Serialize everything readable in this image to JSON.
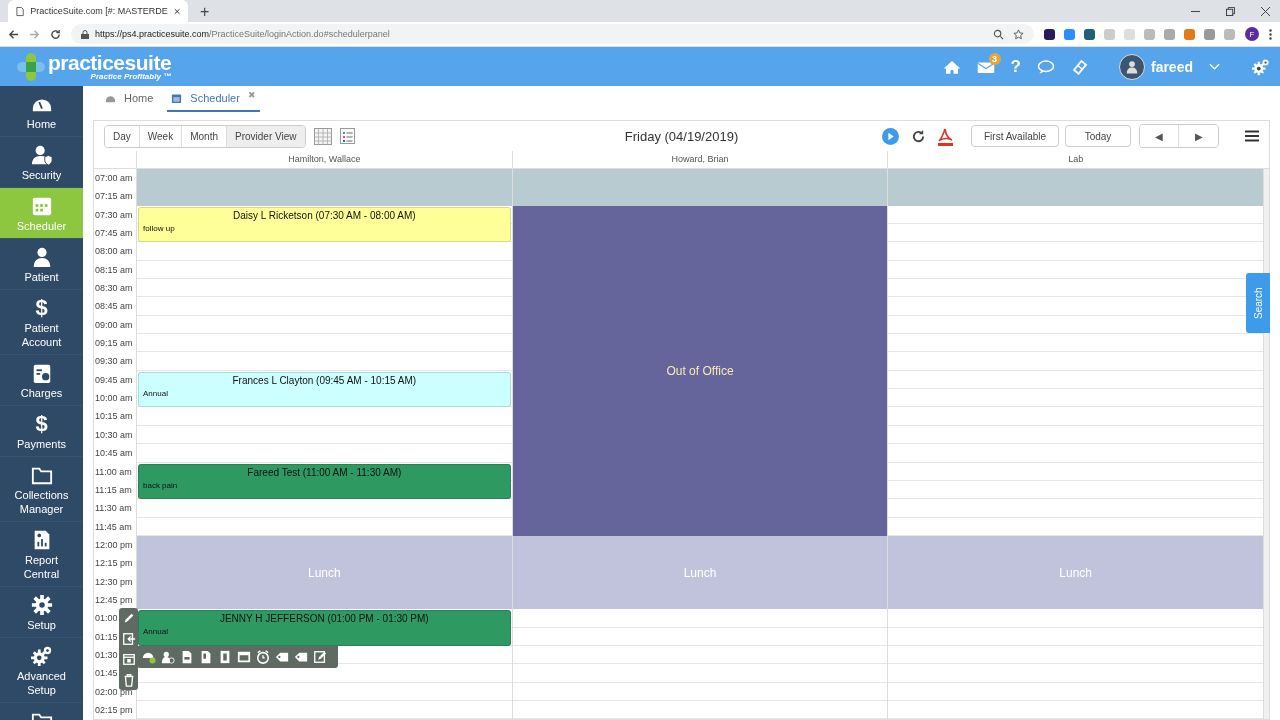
{
  "browser": {
    "tab_title": "PracticeSuite.com [#: MASTERDE",
    "new_tab": "+",
    "url_host": "https://ps4.practicesuite.com",
    "url_path": "/PracticeSuite/loginAction.do#schedulerpanel",
    "profile": "F"
  },
  "header": {
    "logo": "practicesuite",
    "tagline": "Practice Profitably ™",
    "mail_count": "3",
    "help": "?",
    "user": "fareed"
  },
  "sidebar": [
    {
      "label": "Home",
      "selected": false
    },
    {
      "label": "Security",
      "selected": false
    },
    {
      "label": "Scheduler",
      "selected": true
    },
    {
      "label": "Patient",
      "selected": false
    },
    {
      "label": "Patient Account",
      "glyph": "$",
      "selected": false
    },
    {
      "label": "Charges",
      "selected": false
    },
    {
      "label": "Payments",
      "glyph": "$",
      "selected": false
    },
    {
      "label": "Collections Manager",
      "selected": false
    },
    {
      "label": "Report Central",
      "selected": false
    },
    {
      "label": "Setup",
      "selected": false
    },
    {
      "label": "Advanced Setup",
      "selected": false
    }
  ],
  "tabs": [
    {
      "label": "Home",
      "selected": false
    },
    {
      "label": "Scheduler",
      "selected": true,
      "close": "✖"
    }
  ],
  "toolbar": {
    "views": [
      {
        "label": "Day",
        "selected": false
      },
      {
        "label": "Week",
        "selected": false
      },
      {
        "label": "Month",
        "selected": false
      },
      {
        "label": "Provider View",
        "selected": true
      }
    ],
    "date": "Friday (04/19/2019)",
    "first_available": "First Available",
    "today": "Today",
    "prev": "◀",
    "next": "▶"
  },
  "times": [
    "07:00 am",
    "07:15 am",
    "07:30 am",
    "07:45 am",
    "08:00 am",
    "08:15 am",
    "08:30 am",
    "08:45 am",
    "09:00 am",
    "09:15 am",
    "09:30 am",
    "09:45 am",
    "10:00 am",
    "10:15 am",
    "10:30 am",
    "10:45 am",
    "11:00 am",
    "11:15 am",
    "11:30 am",
    "11:45 am",
    "12:00 pm",
    "12:15 pm",
    "12:30 pm",
    "12:45 pm",
    "01:00",
    "01:15",
    "01:30",
    "01:45",
    "02:00 pm",
    "02:15 pm"
  ],
  "columns": [
    {
      "name": "Hamilton, Wallace",
      "slots": [
        {
          "kind": "blocked"
        },
        {
          "kind": "blocked"
        },
        {
          "kind": "appointment",
          "title": "Daisy L Ricketson (07:30 AM - 08:00 AM)",
          "note": "follow up",
          "color": "#ffff99"
        },
        {
          "kind": "continued"
        },
        {
          "kind": "open"
        },
        {
          "kind": "open"
        },
        {
          "kind": "open"
        },
        {
          "kind": "open"
        },
        {
          "kind": "open"
        },
        {
          "kind": "open"
        },
        {
          "kind": "open"
        },
        {
          "kind": "appointment",
          "title": "Frances L Clayton (09:45 AM - 10:15 AM)",
          "note": "Annual",
          "color": "#ccffff"
        },
        {
          "kind": "continued"
        },
        {
          "kind": "open"
        },
        {
          "kind": "open"
        },
        {
          "kind": "open"
        },
        {
          "kind": "appointment",
          "title": "Fareed Test (11:00 AM - 11:30 AM)",
          "note": "back pain",
          "color": "#2e9a62"
        },
        {
          "kind": "continued"
        },
        {
          "kind": "open"
        },
        {
          "kind": "open"
        },
        {
          "kind": "lunch",
          "label": "Lunch"
        },
        {
          "kind": "continued"
        },
        {
          "kind": "continued"
        },
        {
          "kind": "continued"
        },
        {
          "kind": "appointment",
          "title": "JENNY H JEFFERSON (01:00 PM - 01:30 PM)",
          "note": "Annual",
          "color": "#2e9a62"
        },
        {
          "kind": "continued"
        },
        {
          "kind": "open"
        },
        {
          "kind": "open"
        },
        {
          "kind": "open"
        },
        {
          "kind": "open"
        }
      ]
    },
    {
      "name": "Howard, Brian",
      "slots": [
        {
          "kind": "blocked"
        },
        {
          "kind": "blocked"
        },
        {
          "kind": "out",
          "label": "Out of Office"
        },
        {
          "kind": "continued"
        },
        {
          "kind": "continued"
        },
        {
          "kind": "continued"
        },
        {
          "kind": "continued"
        },
        {
          "kind": "continued"
        },
        {
          "kind": "continued"
        },
        {
          "kind": "continued"
        },
        {
          "kind": "continued"
        },
        {
          "kind": "continued"
        },
        {
          "kind": "continued"
        },
        {
          "kind": "continued"
        },
        {
          "kind": "continued"
        },
        {
          "kind": "continued"
        },
        {
          "kind": "continued"
        },
        {
          "kind": "continued"
        },
        {
          "kind": "continued"
        },
        {
          "kind": "continued"
        },
        {
          "kind": "lunch",
          "label": "Lunch"
        },
        {
          "kind": "continued"
        },
        {
          "kind": "continued"
        },
        {
          "kind": "continued"
        },
        {
          "kind": "open"
        },
        {
          "kind": "open"
        },
        {
          "kind": "open"
        },
        {
          "kind": "open"
        },
        {
          "kind": "open"
        },
        {
          "kind": "open"
        }
      ]
    },
    {
      "name": "Lab",
      "slots": [
        {
          "kind": "blocked"
        },
        {
          "kind": "blocked"
        },
        {
          "kind": "open"
        },
        {
          "kind": "open"
        },
        {
          "kind": "open"
        },
        {
          "kind": "open"
        },
        {
          "kind": "open"
        },
        {
          "kind": "open"
        },
        {
          "kind": "open"
        },
        {
          "kind": "open"
        },
        {
          "kind": "open"
        },
        {
          "kind": "open"
        },
        {
          "kind": "open"
        },
        {
          "kind": "open"
        },
        {
          "kind": "open"
        },
        {
          "kind": "open"
        },
        {
          "kind": "open"
        },
        {
          "kind": "open"
        },
        {
          "kind": "open"
        },
        {
          "kind": "open"
        },
        {
          "kind": "lunch",
          "label": "Lunch"
        },
        {
          "kind": "continued"
        },
        {
          "kind": "continued"
        },
        {
          "kind": "continued"
        },
        {
          "kind": "open"
        },
        {
          "kind": "open"
        },
        {
          "kind": "open"
        },
        {
          "kind": "open"
        },
        {
          "kind": "open"
        },
        {
          "kind": "open"
        }
      ]
    }
  ],
  "search_tab": "Search"
}
